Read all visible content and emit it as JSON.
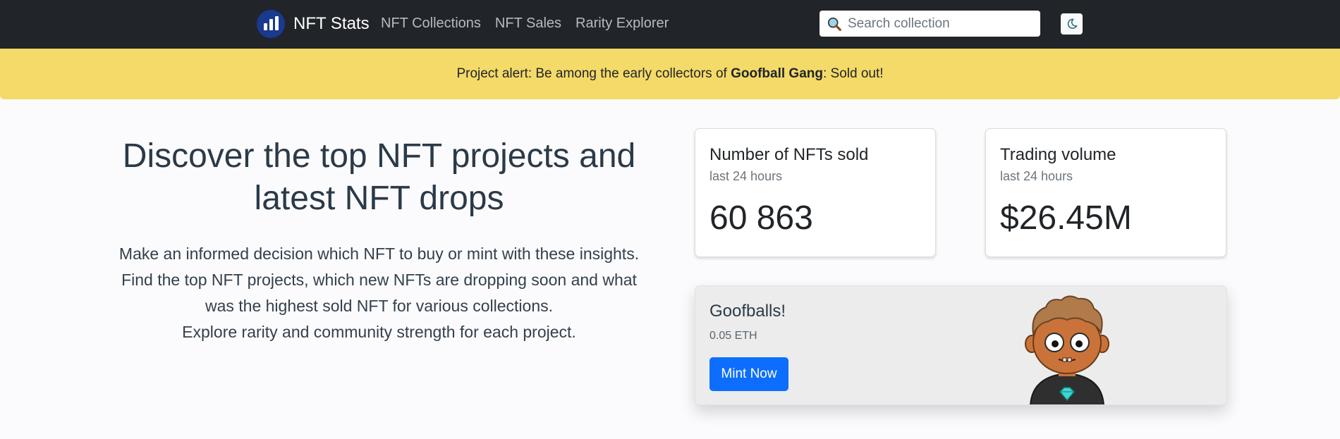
{
  "brand": {
    "name": "NFT Stats"
  },
  "nav": [
    {
      "label": "NFT Collections"
    },
    {
      "label": "NFT Sales"
    },
    {
      "label": "Rarity Explorer"
    }
  ],
  "search": {
    "placeholder": "Search collection",
    "value": ""
  },
  "theme_toggle": {
    "icon": "moon-icon"
  },
  "alert": {
    "prefix": "Project alert: Be among the early collectors of ",
    "project": "Goofball Gang",
    "suffix": ": Sold out!"
  },
  "hero": {
    "title": "Discover the top NFT projects and latest NFT drops",
    "lines": [
      "Make an informed decision which NFT to buy or mint with these insights.",
      "Find the top NFT projects, which new NFTs are dropping soon and what was the highest sold NFT for various collections.",
      "Explore rarity and community strength for each project."
    ]
  },
  "stats": [
    {
      "title": "Number of NFTs sold",
      "subtitle": "last 24 hours",
      "value": "60 863"
    },
    {
      "title": "Trading volume",
      "subtitle": "last 24 hours",
      "value": "$26.45M"
    }
  ],
  "promo": {
    "title": "Goofballs!",
    "price": "0.05 ETH",
    "button_label": "Mint Now",
    "image_icon": "goofball-character-illustration"
  },
  "colors": {
    "navbar_bg": "#212529",
    "alert_bg": "#f4da68",
    "primary_button": "#0d6efd",
    "brand_logo": "#1a3a8f"
  }
}
